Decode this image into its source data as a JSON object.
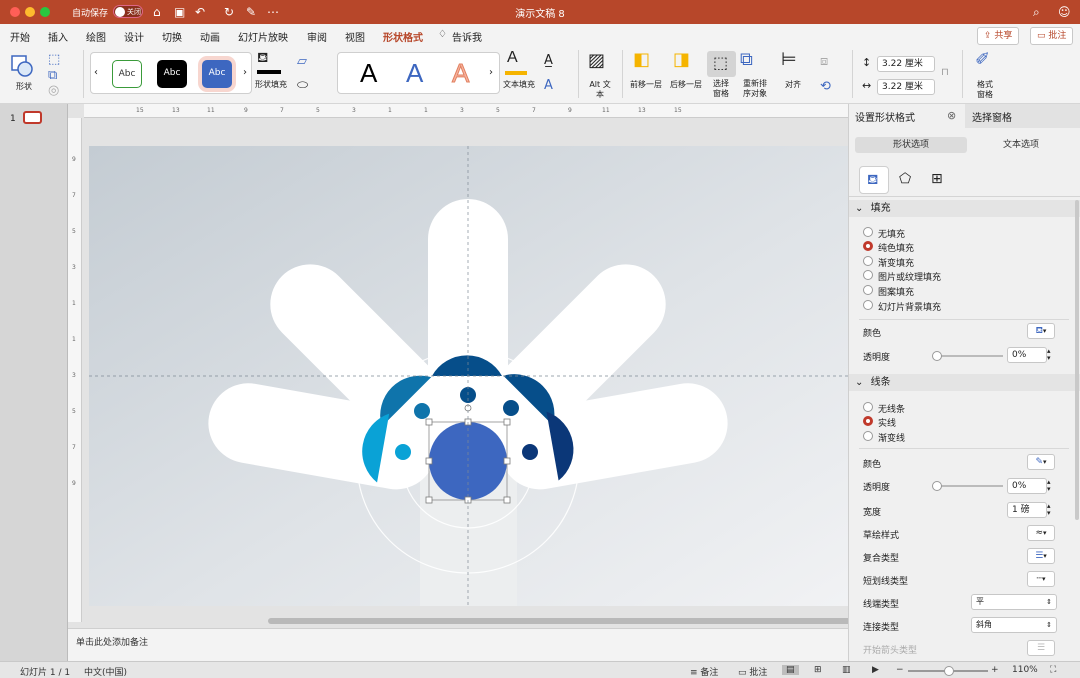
{
  "app": {
    "window_title": "演示文稿 8",
    "autosave_label": "自动保存",
    "autosave_state": "关闭"
  },
  "tabs": [
    "开始",
    "插入",
    "绘图",
    "设计",
    "切换",
    "动画",
    "幻灯片放映",
    "审阅",
    "视图",
    "形状格式"
  ],
  "tell_me": "告诉我",
  "header_buttons": {
    "share": "共享",
    "comments": "批注"
  },
  "ribbon": {
    "shape_label": "形状",
    "style_gallery": [
      "Abc",
      "Abc",
      "Abc"
    ],
    "shape_fill_label": "形状填充",
    "wordart": [
      "A",
      "A",
      "A"
    ],
    "text_fill_label": "文本填充",
    "alt_text_label": "Alt 文本",
    "bring_forward": "前移一层",
    "send_backward": "后移一层",
    "selection_pane": "选择窗格",
    "reorder": "重新排序对象",
    "align": "对齐",
    "height": "3.22 厘米",
    "width": "3.22 厘米",
    "format_pane": "格式窗格"
  },
  "slides": {
    "current_number": "1"
  },
  "notes_placeholder": "单击此处添加备注",
  "panel": {
    "title": "设置形状格式",
    "alt_title": "选择窗格",
    "tabs": [
      "形状选项",
      "文本选项"
    ],
    "fill": {
      "header": "填充",
      "options": [
        "无填充",
        "纯色填充",
        "渐变填充",
        "图片或纹理填充",
        "图案填充",
        "幻灯片背景填充"
      ],
      "selected": 1,
      "color_label": "颜色",
      "transparency_label": "透明度",
      "transparency_value": "0%"
    },
    "line": {
      "header": "线条",
      "options": [
        "无线条",
        "实线",
        "渐变线"
      ],
      "selected": 1,
      "color_label": "颜色",
      "transparency_label": "透明度",
      "transparency_value": "0%",
      "width_label": "宽度",
      "width_value": "1 磅",
      "sketch_label": "草绘样式",
      "compound_label": "复合类型",
      "dash_label": "短划线类型",
      "cap_label": "线端类型",
      "cap_value": "平",
      "join_label": "连接类型",
      "join_value": "斜角",
      "begin_arrow_label": "开始箭头类型"
    }
  },
  "status": {
    "slide_info": "幻灯片 1 / 1",
    "language": "中文(中国)",
    "notes": "备注",
    "comments": "批注",
    "zoom": "110%"
  },
  "colors": {
    "accent": "#b7472a",
    "selected_circle": "#3d67c0",
    "blue_light": "#0aa2d6",
    "blue_mid": "#0f74ab",
    "blue_dark": "#064e8a",
    "navy": "#0b3778"
  }
}
